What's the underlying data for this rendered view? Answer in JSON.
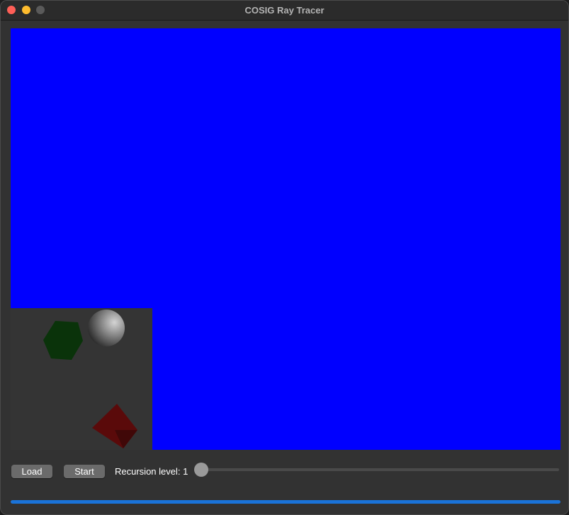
{
  "window": {
    "title": "COSIG Ray Tracer"
  },
  "canvas": {
    "background_color": "#0000ff",
    "tile_background_color": "#343434",
    "objects": [
      {
        "name": "sphere",
        "color": "#bdbdbd"
      },
      {
        "name": "hexagonal-prism",
        "color": "#0a3a0a"
      },
      {
        "name": "tetrahedron",
        "color": "#5a0a0a"
      }
    ]
  },
  "controls": {
    "load_label": "Load",
    "start_label": "Start",
    "recursion_label": "Recursion level: 1",
    "recursion_level": 1,
    "recursion_min": 1
  },
  "progress": {
    "fraction": 1.0,
    "color": "#1a73d9"
  }
}
